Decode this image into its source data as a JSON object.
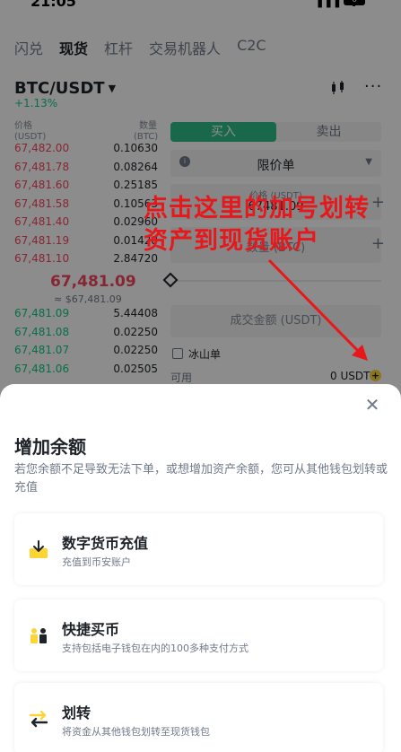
{
  "status_bar": {
    "time": "21:05",
    "signal": "▮▮▮ ᯤ",
    "battery": "6"
  },
  "top_tabs": [
    "闪兑",
    "现货",
    "杠杆",
    "交易机器人",
    "C2C"
  ],
  "pair": {
    "symbol": "BTC/USDT",
    "change": "+1.13%"
  },
  "orderbook": {
    "price_header": "价格\n(USDT)",
    "qty_header": "数量\n(BTC)",
    "asks": [
      {
        "price": "67,482.00",
        "qty": "0.10630"
      },
      {
        "price": "67,481.78",
        "qty": "0.08264"
      },
      {
        "price": "67,481.60",
        "qty": "0.25185"
      },
      {
        "price": "67,481.58",
        "qty": "0.10563"
      },
      {
        "price": "67,481.40",
        "qty": "0.02960"
      },
      {
        "price": "67,481.19",
        "qty": "0.01428"
      },
      {
        "price": "67,481.10",
        "qty": "2.84720"
      }
    ],
    "last_price": "67,481.09",
    "last_price_fiat": "≈ $67,481.09",
    "bids": [
      {
        "price": "67,481.09",
        "qty": "5.44408"
      },
      {
        "price": "67,481.08",
        "qty": "0.02250"
      },
      {
        "price": "67,481.07",
        "qty": "0.02250"
      },
      {
        "price": "67,481.06",
        "qty": "0.02505"
      }
    ]
  },
  "trade_form": {
    "buy_label": "买入",
    "sell_label": "卖出",
    "order_type": "限价单",
    "price_label": "价格 (USDT)",
    "price_value": "67481.09",
    "amount_label": "数量 (BTC)",
    "total_label": "成交金额 (USDT)",
    "iceberg_label": "冰山单",
    "available_label": "可用",
    "available_value": "0 USDT"
  },
  "annotation": "点击这里的加号划转资产到现货账户",
  "sheet": {
    "title": "增加余额",
    "description": "若您余额不足导致无法下单，或想增加资产余额，您可从其他钱包划转或充值",
    "options": [
      {
        "icon": "deposit-icon",
        "title": "数字货币充值",
        "subtitle": "充值到币安账户"
      },
      {
        "icon": "p2p-buy-icon",
        "title": "快捷买币",
        "subtitle": "支持包括电子钱包在内的100多种支付方式"
      },
      {
        "icon": "transfer-icon",
        "title": "划转",
        "subtitle": "将资金从其他钱包划转至现货钱包"
      }
    ]
  },
  "colors": {
    "accent": "#fcd535",
    "buy": "#2ebd85",
    "ask": "#f6465d",
    "bid": "#0ecb81",
    "annotation": "#e8171b"
  }
}
